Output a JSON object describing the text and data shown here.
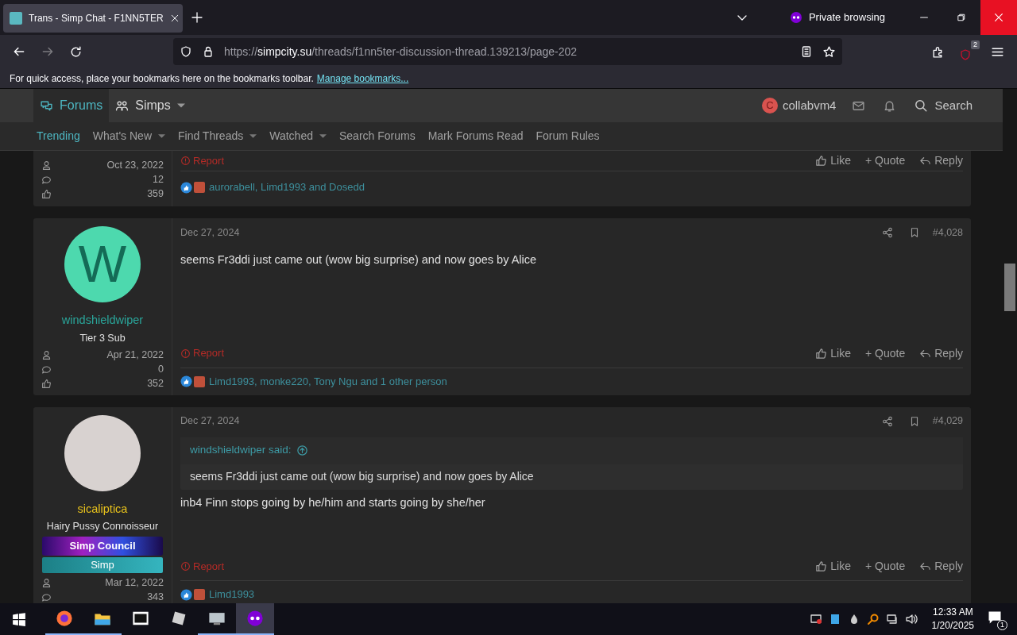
{
  "browser": {
    "tab": {
      "title": "Trans - Simp Chat - F1NN5TER",
      "selected": true
    },
    "private_label": "Private browsing",
    "url": {
      "scheme": "https://",
      "host": "simpcity.su",
      "path": "/threads/f1nn5ter-discussion-thread.139213/page-202"
    },
    "extensions_badge": "2",
    "bookmarks_hint": "For quick access, place your bookmarks here on the bookmarks toolbar.",
    "bookmarks_link": "Manage bookmarks..."
  },
  "site_nav": {
    "tabs": [
      {
        "label": "Forums",
        "selected": true,
        "dropdown": false
      },
      {
        "label": "Simps",
        "selected": false,
        "dropdown": true
      }
    ],
    "user": {
      "initial": "C",
      "name": "collabvm4"
    },
    "search": "Search"
  },
  "sub_nav": [
    {
      "label": "Trending",
      "selected": true,
      "dropdown": false
    },
    {
      "label": "What's New",
      "selected": false,
      "dropdown": true
    },
    {
      "label": "Find Threads",
      "selected": false,
      "dropdown": true
    },
    {
      "label": "Watched",
      "selected": false,
      "dropdown": true
    },
    {
      "label": "Search Forums",
      "selected": false,
      "dropdown": false
    },
    {
      "label": "Mark Forums Read",
      "selected": false,
      "dropdown": false
    },
    {
      "label": "Forum Rules",
      "selected": false,
      "dropdown": false
    }
  ],
  "posts": [
    {
      "kind": "partial",
      "stats": [
        "Oct 23, 2022",
        "12",
        "359"
      ],
      "report": "Report",
      "actions": [
        "Like",
        "+ Quote",
        "Reply"
      ],
      "reactions": "aurorabell, Limd1993 and Dosedd"
    },
    {
      "kind": "full",
      "avatar": {
        "kind": "letter",
        "letter": "W"
      },
      "username": "windshieldwiper",
      "color": "#2aa59a",
      "user_title": "Tier 3 Sub",
      "stats": [
        "Apr 21, 2022",
        "0",
        "352"
      ],
      "date": "Dec 27, 2024",
      "number": "#4,028",
      "body": "seems Fr3ddi just came out (wow big surprise) and now goes by Alice",
      "report": "Report",
      "actions": [
        "Like",
        "+ Quote",
        "Reply"
      ],
      "reactions": "Limd1993, monke220, Tony Ngu and 1 other person"
    },
    {
      "kind": "full",
      "avatar": {
        "kind": "photo"
      },
      "username": "sicaliptica",
      "color": "#e8c21c",
      "user_title": "Hairy Pussy Connoisseur",
      "banners": [
        {
          "kind": "council",
          "label": "Simp Council"
        },
        {
          "kind": "simp",
          "label": "Simp"
        }
      ],
      "stats": [
        "Mar 12, 2022",
        "343"
      ],
      "date": "Dec 27, 2024",
      "number": "#4,029",
      "quote": {
        "author": "windshieldwiper said:",
        "text": "seems Fr3ddi just came out (wow big surprise) and now goes by Alice"
      },
      "body": "inb4 Finn stops going by he/him and starts going by she/her",
      "report": "Report",
      "actions": [
        "Like",
        "+ Quote",
        "Reply"
      ],
      "reactions": "Limd1993"
    }
  ],
  "taskbar": {
    "time": "12:33 AM",
    "date": "1/20/2025",
    "notifications": "1"
  }
}
